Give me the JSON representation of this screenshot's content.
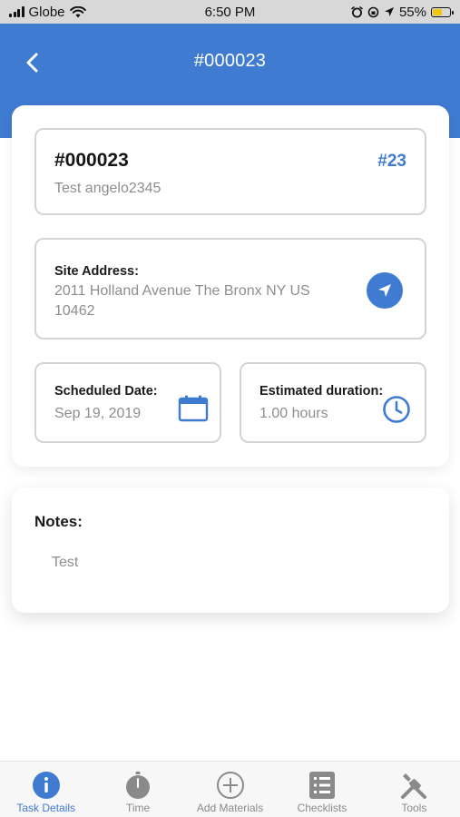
{
  "status_bar": {
    "carrier": "Globe",
    "time": "6:50 PM",
    "battery_percent": "55%",
    "battery_level": 0.55
  },
  "header": {
    "title": "#000023",
    "back_icon": "chevron-left-icon",
    "color": "#3f7bd1"
  },
  "task": {
    "id": "#000023",
    "number": "#23",
    "name": "Test angelo2345"
  },
  "site_address": {
    "label": "Site Address:",
    "value": "2011 Holland Avenue The Bronx NY US 10462",
    "icon": "navigation-arrow-icon"
  },
  "scheduled_date": {
    "label": "Scheduled Date:",
    "value": "Sep 19, 2019",
    "icon": "calendar-icon"
  },
  "estimated_duration": {
    "label": "Estimated duration:",
    "value": "1.00 hours",
    "icon": "clock-icon"
  },
  "notes": {
    "label": "Notes:",
    "text": "Test"
  },
  "tabs": [
    {
      "label": "Task Details",
      "icon": "info-icon",
      "active": true
    },
    {
      "label": "Time",
      "icon": "stopwatch-icon",
      "active": false
    },
    {
      "label": "Add Materials",
      "icon": "add-circle-icon",
      "active": false
    },
    {
      "label": "Checklists",
      "icon": "checklist-icon",
      "active": false
    },
    {
      "label": "Tools",
      "icon": "tools-icon",
      "active": false
    }
  ]
}
